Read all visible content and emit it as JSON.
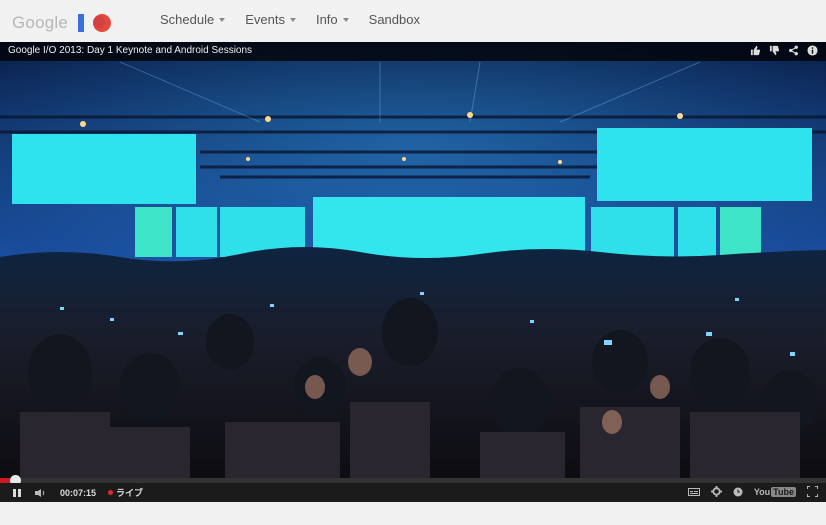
{
  "header": {
    "logo_text": "Google",
    "nav": [
      {
        "label": "Schedule",
        "has_dropdown": true
      },
      {
        "label": "Events",
        "has_dropdown": true
      },
      {
        "label": "Info",
        "has_dropdown": true
      },
      {
        "label": "Sandbox",
        "has_dropdown": false
      }
    ]
  },
  "player": {
    "title": "Google I/O 2013: Day 1 Keynote and Android Sessions",
    "time": "00:07:15",
    "live_label": "ライブ",
    "progress_fraction": 0.018,
    "youtube_logo": {
      "you": "You",
      "tube": "Tube"
    },
    "title_icons": [
      "thumbs-up-icon",
      "thumbs-down-icon",
      "share-icon",
      "info-icon"
    ],
    "control_icons": [
      "pause-icon",
      "volume-icon",
      "captions-icon",
      "settings-icon",
      "watch-later-icon",
      "youtube-logo",
      "fullscreen-icon"
    ]
  },
  "colors": {
    "progress": "#cc181e",
    "stage_cyan": "#28e0e6",
    "hall_blue": "#1a4fa0",
    "logo_blue": "#3a6fd8",
    "logo_red": "#e44a3c"
  }
}
